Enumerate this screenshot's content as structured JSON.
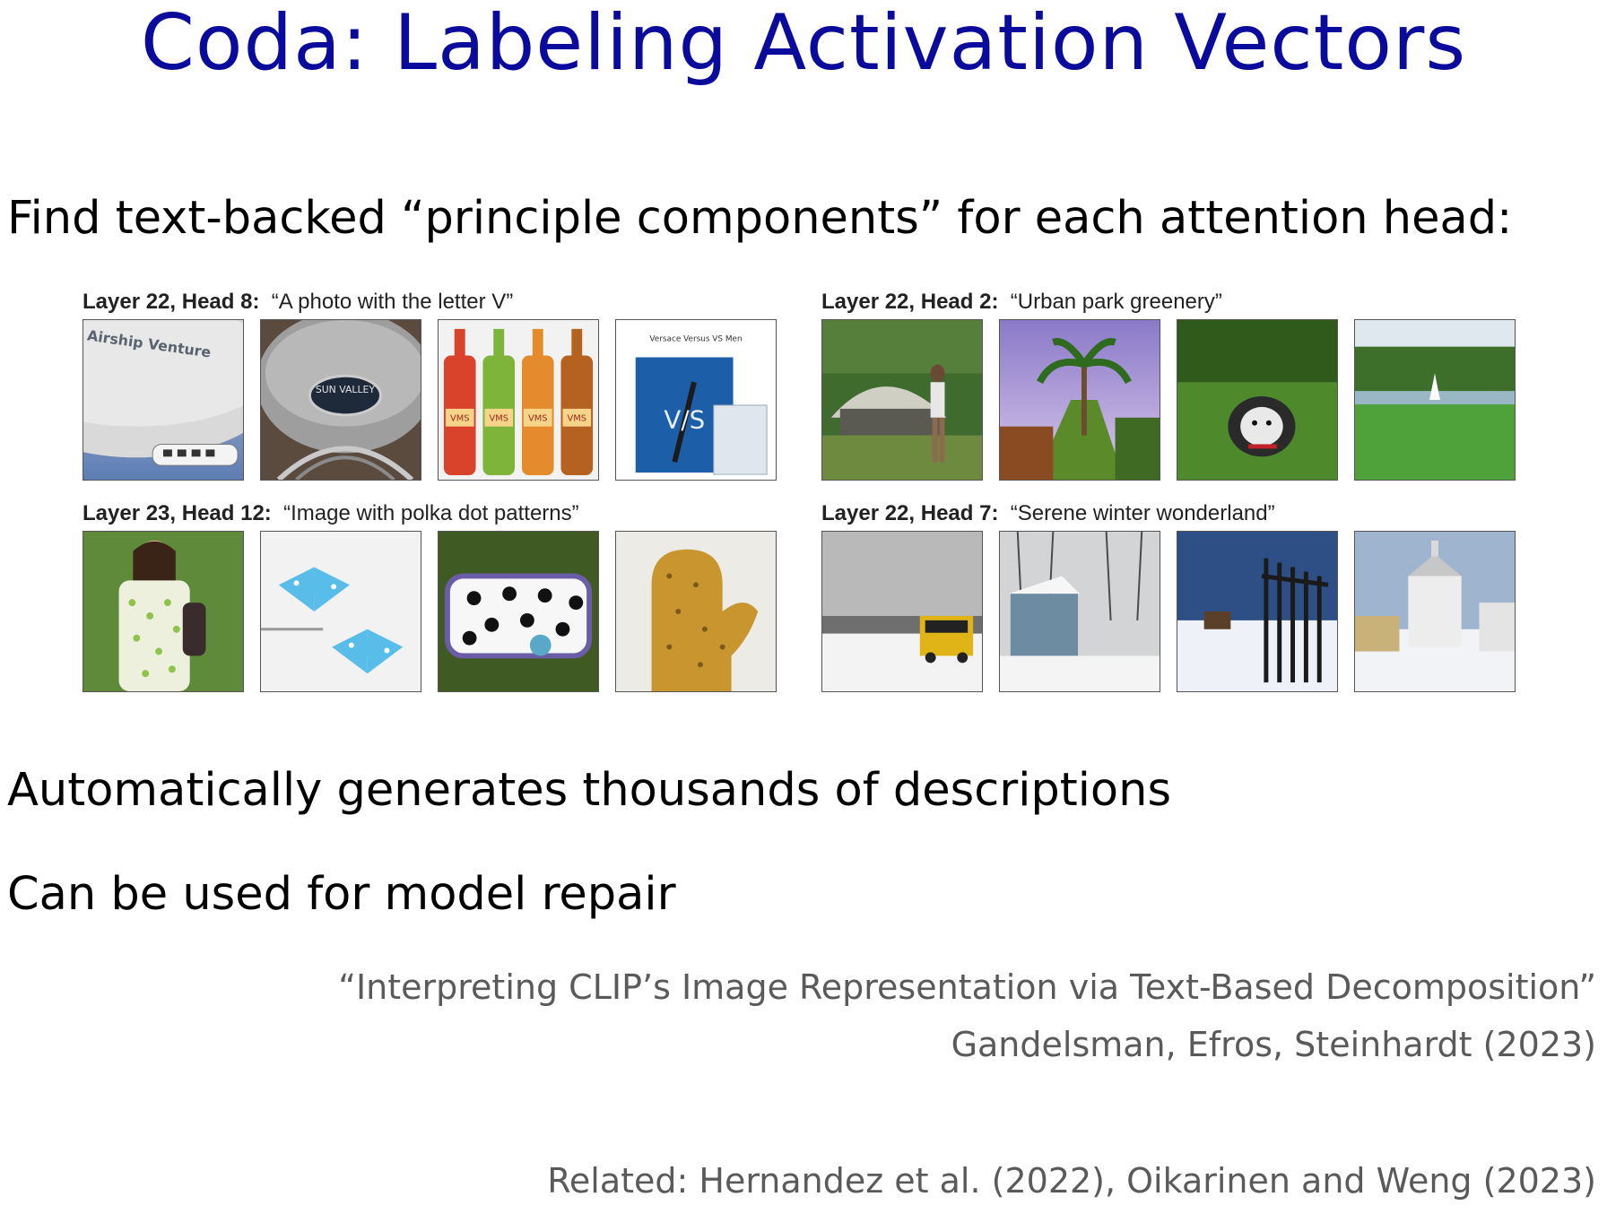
{
  "slide": {
    "title": "Coda: Labeling Activation Vectors",
    "bullets": [
      "Find text-backed “principle components” for each attention head:",
      "Automatically generates thousands of descriptions",
      "Can be used for model repair"
    ],
    "citation": {
      "paper": "“Interpreting CLIP’s Image Representation via Text-Based Decomposition”",
      "authors": "Gandelsman, Efros, Steinhardt (2023)"
    },
    "related": "Related: Hernandez et al. (2022), Oikarinen and Weng (2023)"
  },
  "figure": {
    "panels": [
      {
        "head": "Layer 22, Head 8:",
        "description": "“A photo with the letter V”",
        "image_text": [
          "Airship Venture",
          "SUN VALLEY",
          "VMS",
          "Versace Versus VS Men",
          "V/S"
        ]
      },
      {
        "head": "Layer 22, Head 2:",
        "description": "“Urban park greenery”",
        "image_text": []
      },
      {
        "head": "Layer 23, Head 12:",
        "description": "“Image with polka dot patterns”",
        "image_text": []
      },
      {
        "head": "Layer 22, Head 7:",
        "description": "“Serene winter wonderland”",
        "image_text": []
      }
    ]
  }
}
